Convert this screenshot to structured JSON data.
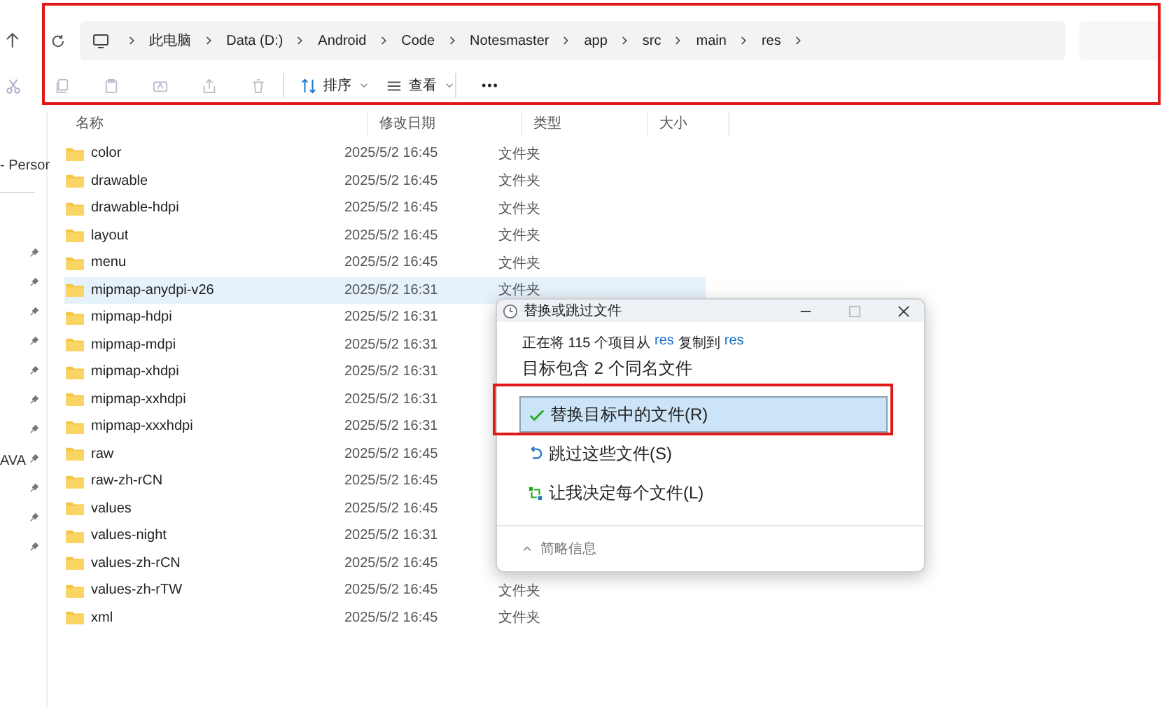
{
  "address_bar": {
    "root": "此电脑",
    "path": [
      "Data (D:)",
      "Android",
      "Code",
      "Notesmaster",
      "app",
      "src",
      "main",
      "res"
    ]
  },
  "toolbar": {
    "sort": "排序",
    "view": "查看",
    "more": "•••"
  },
  "table": {
    "columns": [
      "名称",
      "修改日期",
      "类型",
      "大小"
    ],
    "rows": [
      {
        "name": "color",
        "date": "2025/5/2 16:45",
        "type": "文件夹",
        "selected": false
      },
      {
        "name": "drawable",
        "date": "2025/5/2 16:45",
        "type": "文件夹",
        "selected": false
      },
      {
        "name": "drawable-hdpi",
        "date": "2025/5/2 16:45",
        "type": "文件夹",
        "selected": false
      },
      {
        "name": "layout",
        "date": "2025/5/2 16:45",
        "type": "文件夹",
        "selected": false
      },
      {
        "name": "menu",
        "date": "2025/5/2 16:45",
        "type": "文件夹",
        "selected": false
      },
      {
        "name": "mipmap-anydpi-v26",
        "date": "2025/5/2 16:31",
        "type": "文件夹",
        "selected": true
      },
      {
        "name": "mipmap-hdpi",
        "date": "2025/5/2 16:31",
        "selected": false
      },
      {
        "name": "mipmap-mdpi",
        "date": "2025/5/2 16:31",
        "selected": false
      },
      {
        "name": "mipmap-xhdpi",
        "date": "2025/5/2 16:31",
        "selected": false
      },
      {
        "name": "mipmap-xxhdpi",
        "date": "2025/5/2 16:31",
        "selected": false
      },
      {
        "name": "mipmap-xxxhdpi",
        "date": "2025/5/2 16:31",
        "selected": false
      },
      {
        "name": "raw",
        "date": "2025/5/2 16:45",
        "selected": false
      },
      {
        "name": "raw-zh-rCN",
        "date": "2025/5/2 16:45",
        "selected": false
      },
      {
        "name": "values",
        "date": "2025/5/2 16:45",
        "selected": false
      },
      {
        "name": "values-night",
        "date": "2025/5/2 16:31",
        "selected": false
      },
      {
        "name": "values-zh-rCN",
        "date": "2025/5/2 16:45",
        "selected": false
      },
      {
        "name": "values-zh-rTW",
        "date": "2025/5/2 16:45",
        "type": "文件夹",
        "selected": false
      },
      {
        "name": "xml",
        "date": "2025/5/2 16:45",
        "type": "文件夹",
        "selected": false
      }
    ]
  },
  "sidebar": {
    "items": [
      {
        "label": "- Persor",
        "pinned": false
      },
      {
        "pinned": true
      },
      {
        "pinned": true
      },
      {
        "pinned": true
      },
      {
        "pinned": true
      },
      {
        "pinned": true
      },
      {
        "pinned": true
      },
      {
        "pinned": true
      },
      {
        "label": "AVA",
        "pinned": true
      },
      {
        "pinned": true
      },
      {
        "pinned": true
      },
      {
        "pinned": true
      }
    ]
  },
  "dialog": {
    "title": "替换或跳过文件",
    "status": {
      "prefix": "正在将 115 个项目从",
      "from": "res",
      "middle": "复制到",
      "to": "res"
    },
    "heading": "目标包含 2 个同名文件",
    "options": [
      {
        "kind": "replace",
        "label": "替换目标中的文件(R)",
        "selected": true
      },
      {
        "kind": "skip",
        "label": "跳过这些文件(S)",
        "selected": false
      },
      {
        "kind": "decide",
        "label": "让我决定每个文件(L)",
        "selected": false
      }
    ],
    "details": "简略信息"
  }
}
